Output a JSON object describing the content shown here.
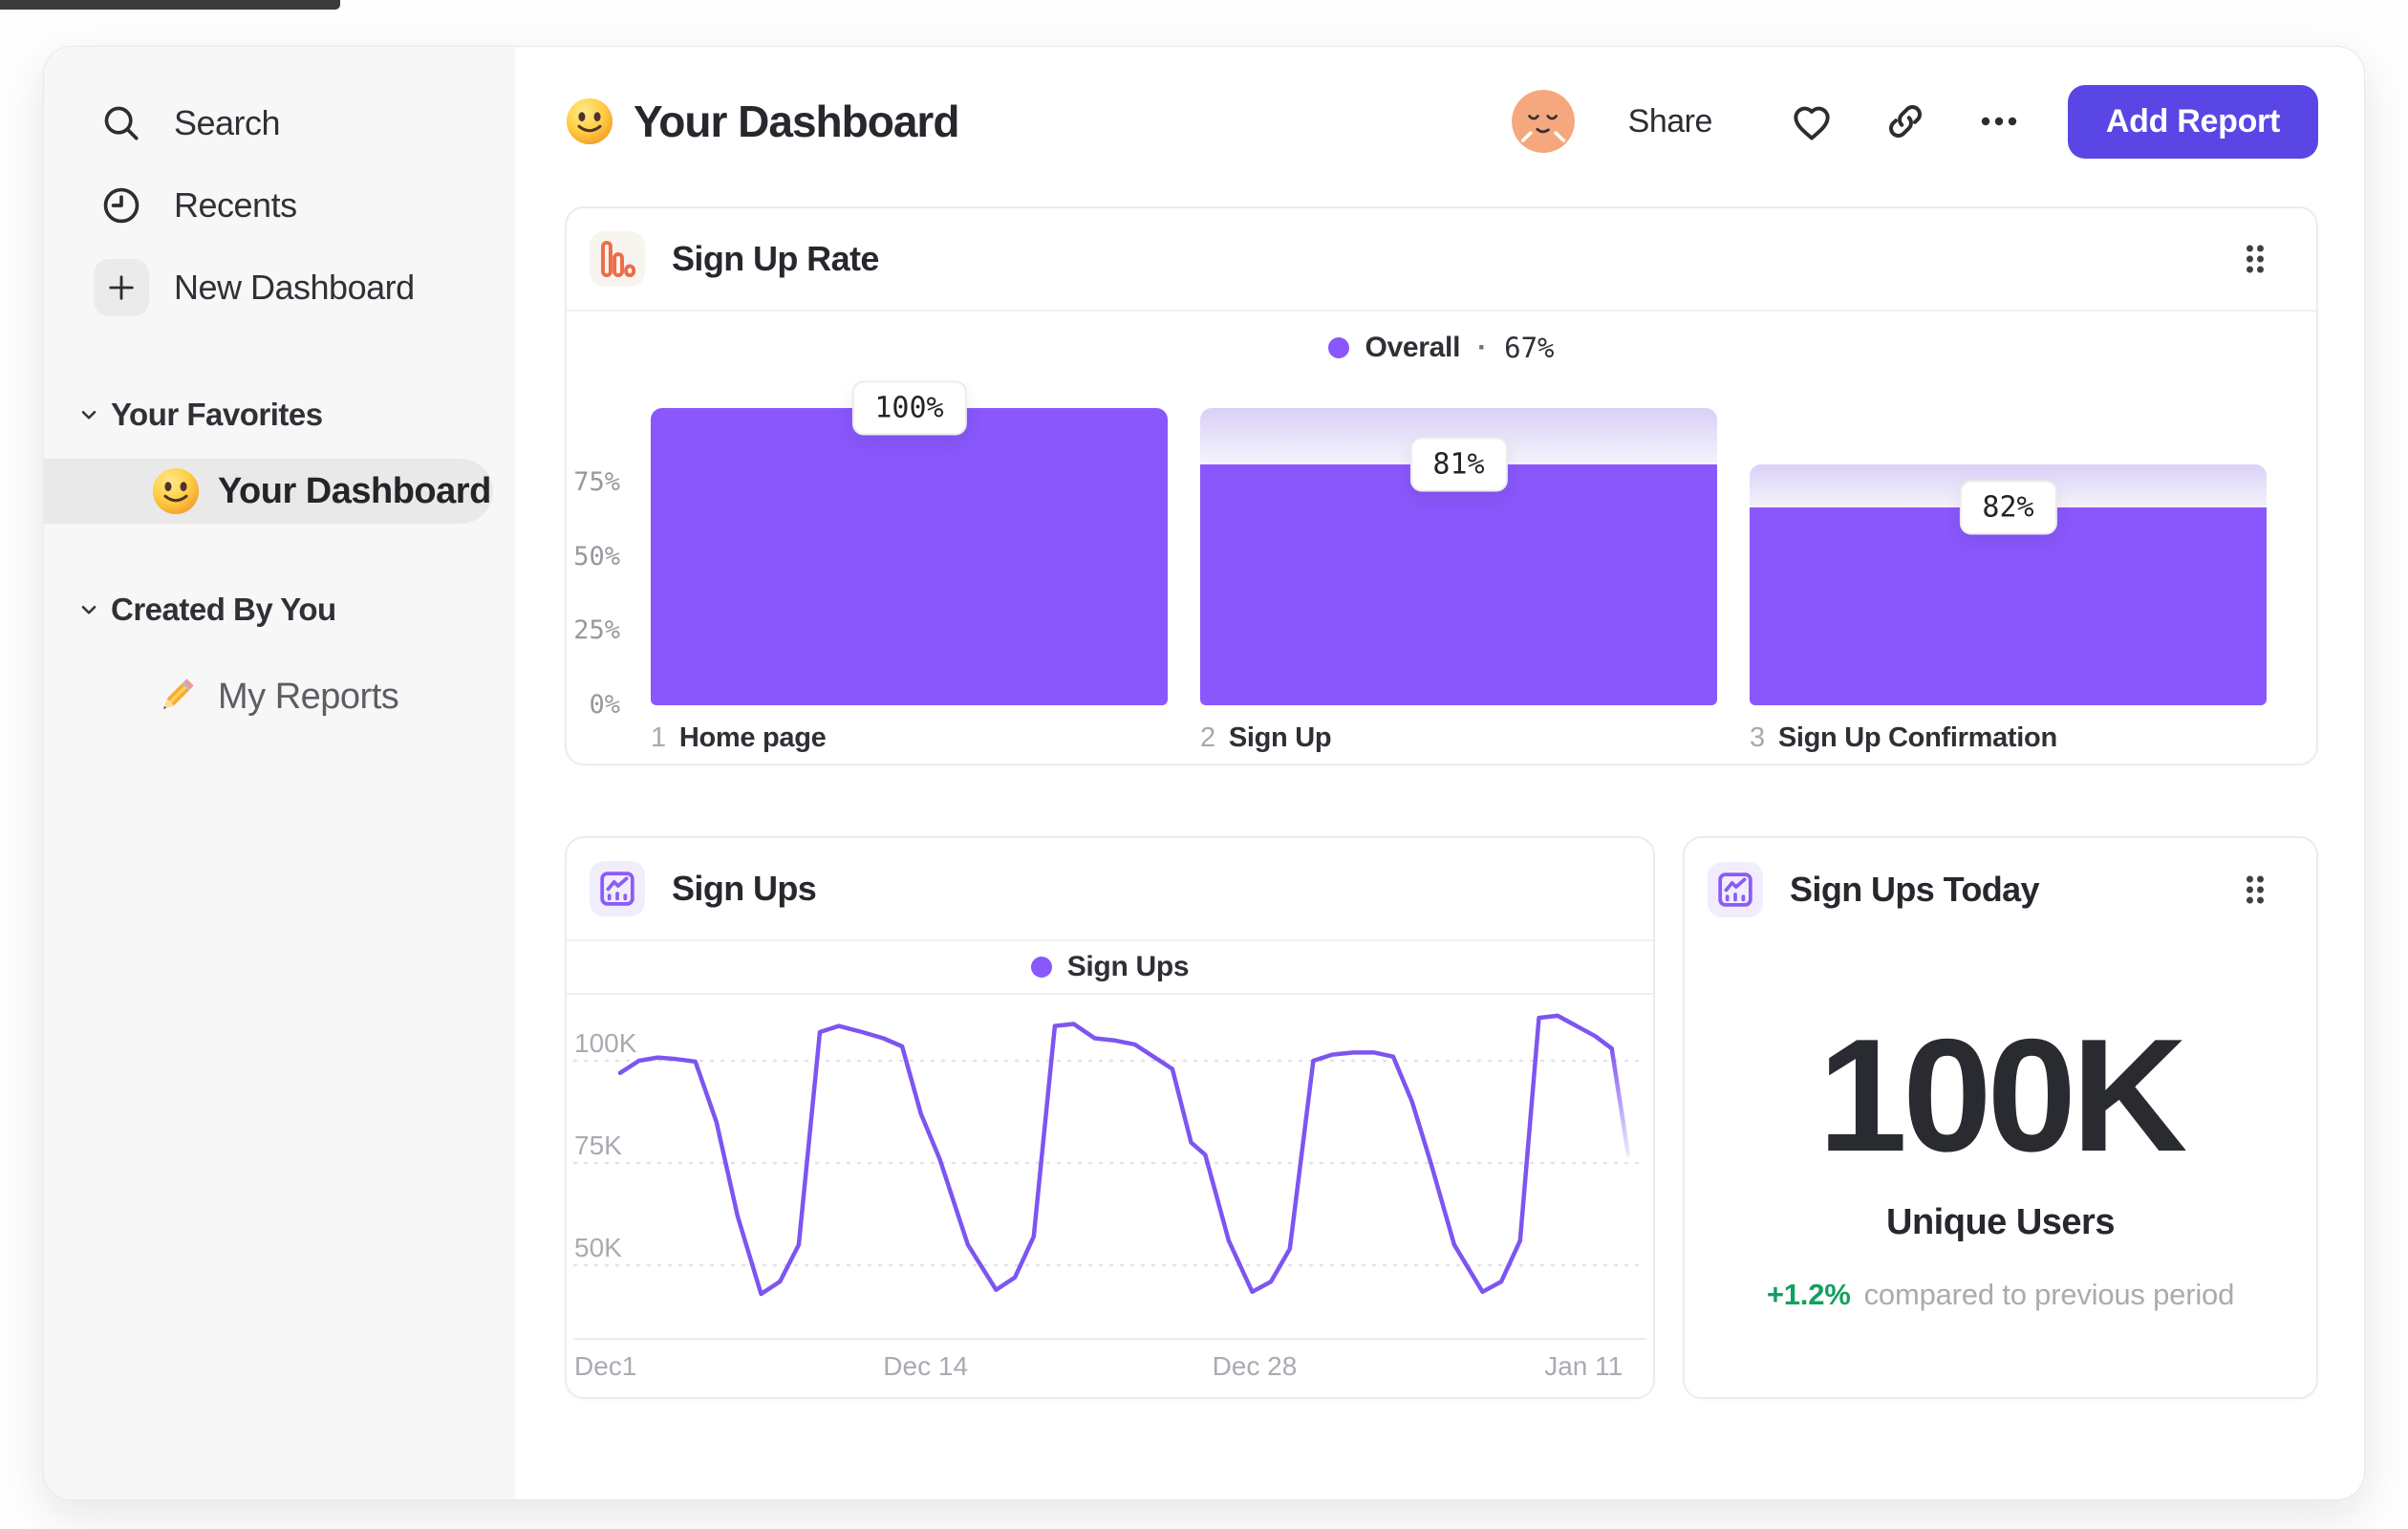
{
  "app": {
    "title": "Your Dashboard",
    "share": "Share",
    "add_report": "Add Report"
  },
  "sidebar": {
    "search": "Search",
    "recents": "Recents",
    "new_dashboard": "New Dashboard",
    "sections": [
      {
        "title": "Your Favorites",
        "item": "Your Dashboard"
      },
      {
        "title": "Created By You",
        "item": "My Reports"
      }
    ]
  },
  "cards": {
    "signup_rate": {
      "title": "Sign Up Rate",
      "legend_label": "Overall",
      "legend_sep": "·",
      "legend_value": "67%"
    },
    "sign_ups": {
      "title": "Sign Ups",
      "legend_label": "Sign Ups"
    },
    "sign_ups_today": {
      "title": "Sign Ups Today",
      "value": "100K",
      "value_label": "Unique Users",
      "delta": "+1.2%",
      "delta_note": "compared to previous period"
    }
  },
  "colors": {
    "bar_purple": "#8957fb",
    "line_purple": "#7d55f0",
    "button_purple": "#5946e4",
    "icon_orange": "#ed6d4b",
    "icon_purple": "#8a5cf5",
    "delta_green": "#12a05f",
    "gradient_top": "#d9d0f6"
  },
  "chart_data": [
    {
      "type": "bar",
      "subtype": "funnel",
      "title": "Sign Up Rate",
      "legend": "Overall · 67%",
      "categories": [
        "Home page",
        "Sign Up",
        "Sign Up Confirmation"
      ],
      "step_labels": [
        "1",
        "2",
        "3"
      ],
      "step_conversion_pct": [
        100,
        81,
        82
      ],
      "absolute_pct": [
        100,
        81,
        66.4
      ],
      "overall_pct": 67,
      "y_ticks_pct": [
        75,
        50,
        25,
        0
      ],
      "ylim": [
        0,
        100
      ],
      "bar_color": "#8957fb"
    },
    {
      "type": "line",
      "title": "Sign Ups",
      "legend": "Sign Ups",
      "unit": "K sign ups",
      "x_unit": "days since Dec 1",
      "x_ticks": [
        {
          "label": "Dec1",
          "day": 0
        },
        {
          "label": "Dec 14",
          "day": 13
        },
        {
          "label": "Dec 28",
          "day": 27
        },
        {
          "label": "Jan 11",
          "day": 41
        }
      ],
      "y_ticks": [
        {
          "label": "100K",
          "k": 100
        },
        {
          "label": "75K",
          "k": 75
        },
        {
          "label": "50K",
          "k": 50
        }
      ],
      "ylim_k": [
        40,
        115
      ],
      "grid": "dashed-horizontal",
      "line_color": "#7d55f0",
      "fading_tail_points": 2,
      "series": [
        [
          0,
          97
        ],
        [
          0.8,
          100
        ],
        [
          1.6,
          100.8
        ],
        [
          2.4,
          100.4
        ],
        [
          3.2,
          99.8
        ],
        [
          4.1,
          85
        ],
        [
          5,
          62
        ],
        [
          6,
          43
        ],
        [
          6.8,
          46
        ],
        [
          7.6,
          55
        ],
        [
          8.5,
          107
        ],
        [
          9.3,
          108.5
        ],
        [
          10.3,
          107
        ],
        [
          11.2,
          105.5
        ],
        [
          12,
          103.5
        ],
        [
          12.8,
          87
        ],
        [
          13.6,
          76
        ],
        [
          14.8,
          55
        ],
        [
          16,
          44
        ],
        [
          16.8,
          47
        ],
        [
          17.6,
          57
        ],
        [
          18.5,
          108.5
        ],
        [
          19.3,
          109
        ],
        [
          20.2,
          105.5
        ],
        [
          21,
          105
        ],
        [
          21.9,
          104
        ],
        [
          22.7,
          101
        ],
        [
          23.5,
          98
        ],
        [
          24.3,
          80
        ],
        [
          24.9,
          77
        ],
        [
          25.9,
          56
        ],
        [
          26.9,
          43.5
        ],
        [
          27.7,
          46
        ],
        [
          28.5,
          54
        ],
        [
          29.5,
          100
        ],
        [
          30.3,
          101.5
        ],
        [
          31.2,
          102
        ],
        [
          32.1,
          102
        ],
        [
          32.9,
          101
        ],
        [
          33.7,
          90
        ],
        [
          34.5,
          75
        ],
        [
          35.5,
          55
        ],
        [
          36.7,
          43.5
        ],
        [
          37.5,
          46
        ],
        [
          38.3,
          56
        ],
        [
          39.1,
          110.5
        ],
        [
          39.9,
          111
        ],
        [
          40.7,
          108.5
        ],
        [
          41.5,
          106
        ],
        [
          42.2,
          103
        ],
        [
          42.9,
          77
        ]
      ]
    }
  ]
}
